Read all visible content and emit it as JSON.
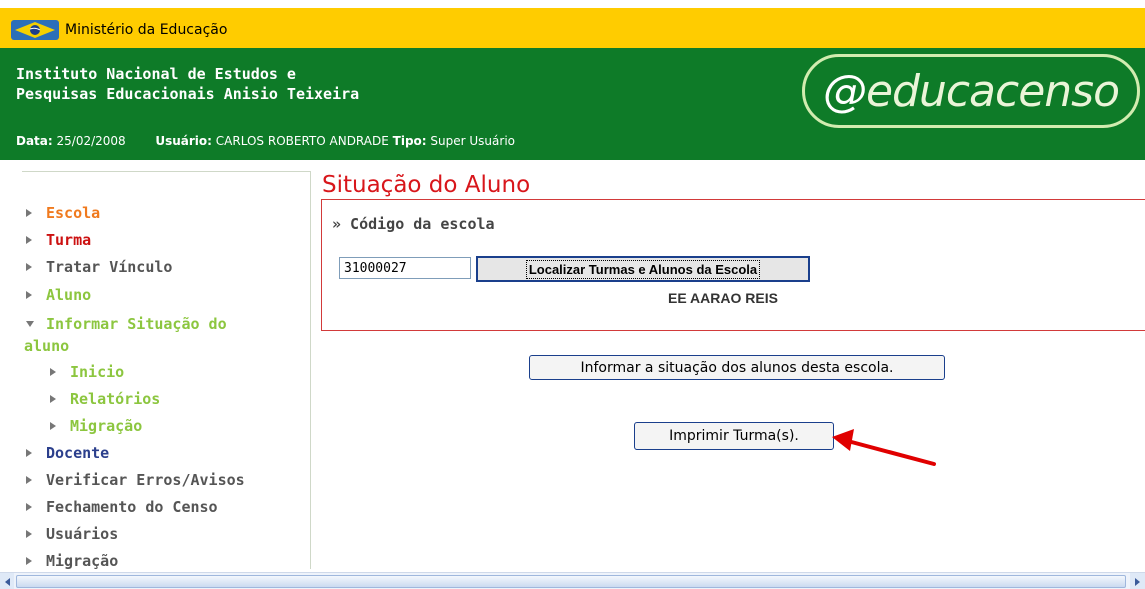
{
  "ministry": {
    "name": "Ministério da Educação",
    "icon": "brazil-flag-icon"
  },
  "header": {
    "institute_line1": "Instituto Nacional de Estudos e",
    "institute_line2": "Pesquisas Educacionais Anisio Teixeira",
    "logo_e": "@",
    "logo_rest": "educacenso",
    "date_label": "Data:",
    "date_value": "25/02/2008",
    "user_label": "Usuário:",
    "user_value": "CARLOS ROBERTO ANDRADE",
    "type_label": "Tipo:",
    "type_value": "Super Usuário"
  },
  "sidebar": {
    "items": [
      {
        "label": "Escola",
        "color": "#f07a1e"
      },
      {
        "label": "Turma",
        "color": "#cc1111"
      },
      {
        "label": "Tratar Vínculo",
        "color": "#555555"
      },
      {
        "label": "Aluno",
        "color": "#8cc63f"
      },
      {
        "label": "Informar Situação do",
        "label2": "aluno",
        "color": "#8cc63f"
      },
      {
        "label": "Inicio",
        "color": "#8cc63f"
      },
      {
        "label": "Relatórios",
        "color": "#8cc63f"
      },
      {
        "label": "Migração",
        "color": "#8cc63f"
      },
      {
        "label": "Docente",
        "color": "#2b3f8c"
      },
      {
        "label": "Verificar Erros/Avisos",
        "color": "#555555"
      },
      {
        "label": "Fechamento do Censo",
        "color": "#555555"
      },
      {
        "label": "Usuários",
        "color": "#555555"
      },
      {
        "label": "Migração",
        "color": "#555555"
      }
    ]
  },
  "main": {
    "title": "Situação do Aluno",
    "panel_label": "» Código da escola",
    "school_code": "31000027",
    "find_button": "Localizar Turmas e Alunos da Escola",
    "school_name": "EE AARAO REIS",
    "inform_button": "Informar a situação dos alunos desta escola.",
    "print_button": "Imprimir Turma(s)."
  },
  "colors": {
    "header_green": "#0e7b28",
    "ministry_yellow": "#ffcc00",
    "title_red": "#d8161b",
    "annotation_red": "#e00000"
  }
}
